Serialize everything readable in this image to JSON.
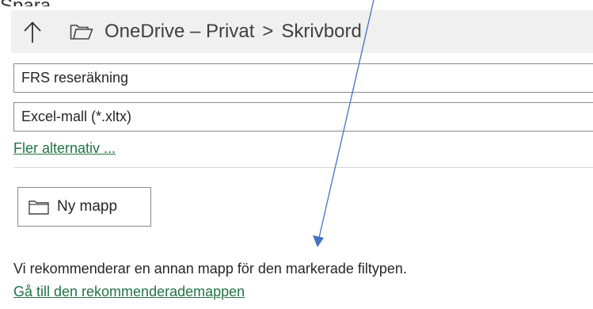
{
  "page": {
    "heading": "Spara"
  },
  "location_bar": {
    "path_root": "OneDrive – Privat",
    "separator": ">",
    "path_folder": "Skrivbord",
    "icons": [
      "up-arrow-icon",
      "folder-icon"
    ]
  },
  "file_name": {
    "value": "FRS reseräkning"
  },
  "file_type": {
    "value": "Excel-mall (*.xltx)"
  },
  "more_options": {
    "label": "Fler alternativ ..."
  },
  "new_folder": {
    "label": "Ny mapp",
    "icon": "folder-icon"
  },
  "recommendation": {
    "message": "Vi rekommenderar en annan mapp för den markerade filtypen.",
    "link_label": "Gå till den rekommenderademappen"
  },
  "colors": {
    "link": "#217346",
    "location_bar_bg": "#f0f0f0",
    "annotation_arrow": "#4472c4"
  }
}
